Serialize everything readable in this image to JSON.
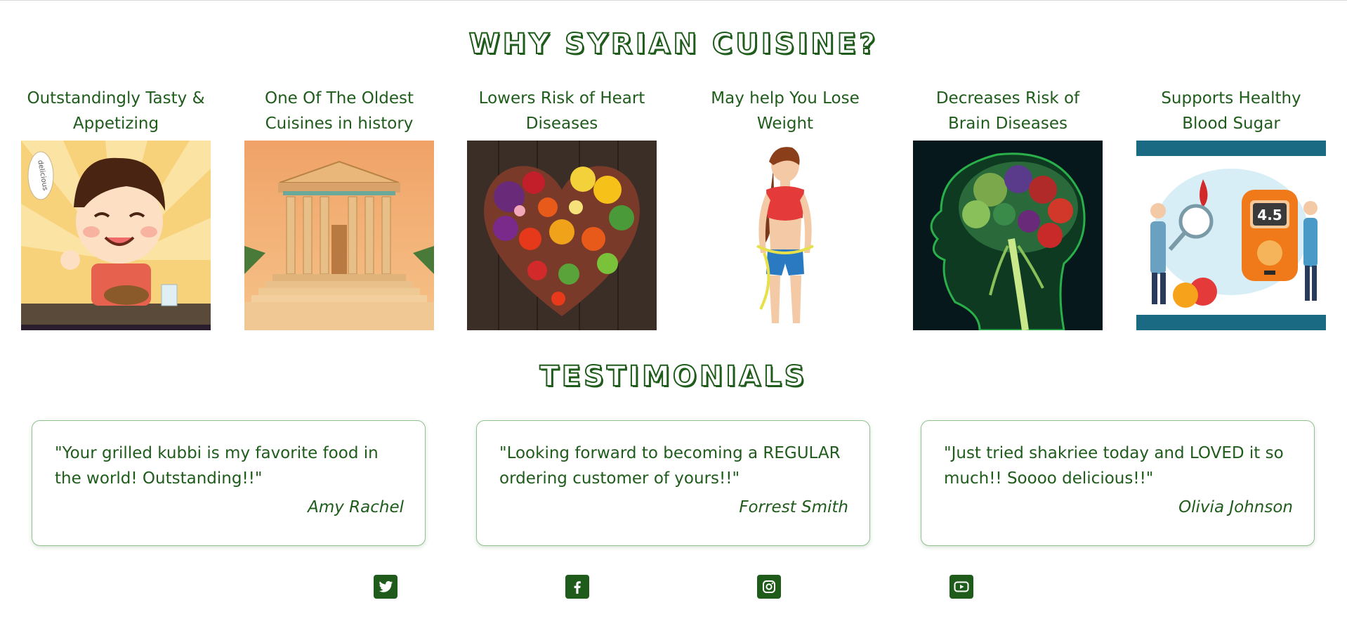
{
  "why_section": {
    "title": "WHY SYRIAN CUISINE?",
    "benefits": [
      {
        "caption": "Outstandingly Tasty & Appetizing",
        "image": "boy-tasting-food-illustration",
        "bubble_text": "delicious"
      },
      {
        "caption": "One Of The Oldest Cuisines in history",
        "image": "ancient-temple-illustration"
      },
      {
        "caption": "Lowers Risk of Heart Diseases",
        "image": "heart-of-fruits-and-vegetables"
      },
      {
        "caption": "May help You Lose Weight",
        "image": "woman-measuring-waist"
      },
      {
        "caption": "Decreases Risk of Brain Diseases",
        "image": "brain-made-of-vegetables"
      },
      {
        "caption": "Supports Healthy Blood Sugar",
        "image": "glucose-meter-illustration",
        "meter_reading": "4.5"
      }
    ]
  },
  "testimonials": {
    "title": "TESTIMONIALS",
    "items": [
      {
        "quote": "\"Your grilled kubbi is my favorite food in the world! Outstanding!!\"",
        "author": "Amy Rachel"
      },
      {
        "quote": "\"Looking forward to becoming a REGULAR ordering customer of yours!!\"",
        "author": "Forrest Smith"
      },
      {
        "quote": "\"Just tried shakriee today and LOVED it so much!! Soooo delicious!!\"",
        "author": "Olivia Johnson"
      }
    ]
  },
  "social": {
    "icons": [
      "twitter-icon",
      "facebook-icon",
      "instagram-icon",
      "youtube-icon"
    ]
  },
  "colors": {
    "brand_green": "#1f5c1c",
    "card_border": "#8fc28f",
    "background": "#ffffff"
  }
}
